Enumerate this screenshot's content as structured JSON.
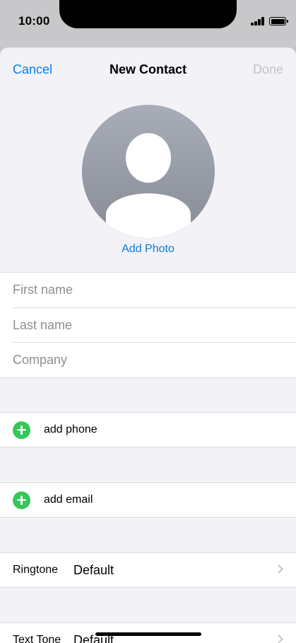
{
  "status_bar": {
    "time": "10:00"
  },
  "nav": {
    "cancel": "Cancel",
    "title": "New Contact",
    "done": "Done"
  },
  "photo": {
    "add_label": "Add Photo"
  },
  "name_fields": {
    "first_placeholder": "First name",
    "last_placeholder": "Last name",
    "company_placeholder": "Company"
  },
  "add_phone": "add phone",
  "add_email": "add email",
  "ringtone": {
    "label": "Ringtone",
    "value": "Default"
  },
  "text_tone": {
    "label": "Text Tone",
    "value": "Default"
  },
  "icons": [
    "signal-icon",
    "battery-icon",
    "avatar-placeholder-icon",
    "add-icon",
    "chevron-right-icon"
  ],
  "colors": {
    "accent": "#0a7de0",
    "add_green": "#34c759",
    "done_disabled": "#c3c3c7"
  }
}
